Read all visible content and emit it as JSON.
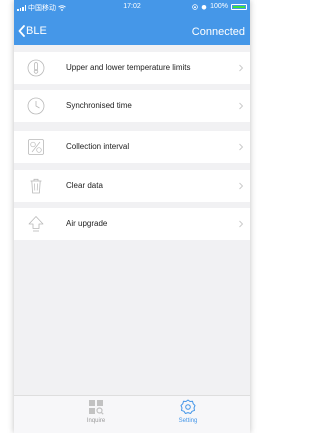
{
  "status_bar": {
    "carrier": "中国移动",
    "time": "17:02",
    "battery": "100%"
  },
  "nav": {
    "back_label": "BLE",
    "status": "Connected"
  },
  "menu": {
    "items": [
      {
        "label": "Upper and lower temperature limits",
        "icon": "thermometer-icon"
      },
      {
        "label": "Synchronised time",
        "icon": "clock-icon"
      },
      {
        "label": "Collection interval",
        "icon": "interval-icon"
      },
      {
        "label": "Clear data",
        "icon": "trash-icon"
      },
      {
        "label": "Air upgrade",
        "icon": "upload-arrow-icon"
      }
    ]
  },
  "tabs": [
    {
      "label": "Inquire",
      "icon": "inquire-grid-icon",
      "active": false
    },
    {
      "label": "Setting",
      "icon": "gear-icon",
      "active": true
    }
  ],
  "colors": {
    "accent": "#4597e8",
    "background": "#f1f1f3",
    "icon_gray": "#b8b8b8"
  }
}
